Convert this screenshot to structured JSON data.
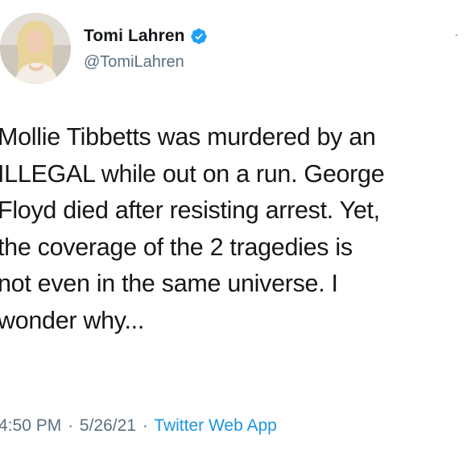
{
  "tweet": {
    "author": {
      "display_name": "Tomi Lahren",
      "handle": "@TomiLahren",
      "verified": true
    },
    "body_lines": [
      "Mollie Tibbetts was murdered by an",
      "ILLEGAL while out on a run. George",
      "Floyd died after resisting arrest. Yet,",
      "the coverage of the 2 tragedies is",
      "not even in the same universe. I",
      "wonder why..."
    ],
    "time": "4:50 PM",
    "date": "5/26/21",
    "separator": "·",
    "source": "Twitter Web App"
  },
  "colors": {
    "text": "#14171a",
    "secondary": "#5b7083",
    "link": "#1b95e0",
    "verified_badge": "#1da1f2"
  },
  "icons": {
    "verified": "verified-badge-icon",
    "more": "more-options-icon"
  }
}
